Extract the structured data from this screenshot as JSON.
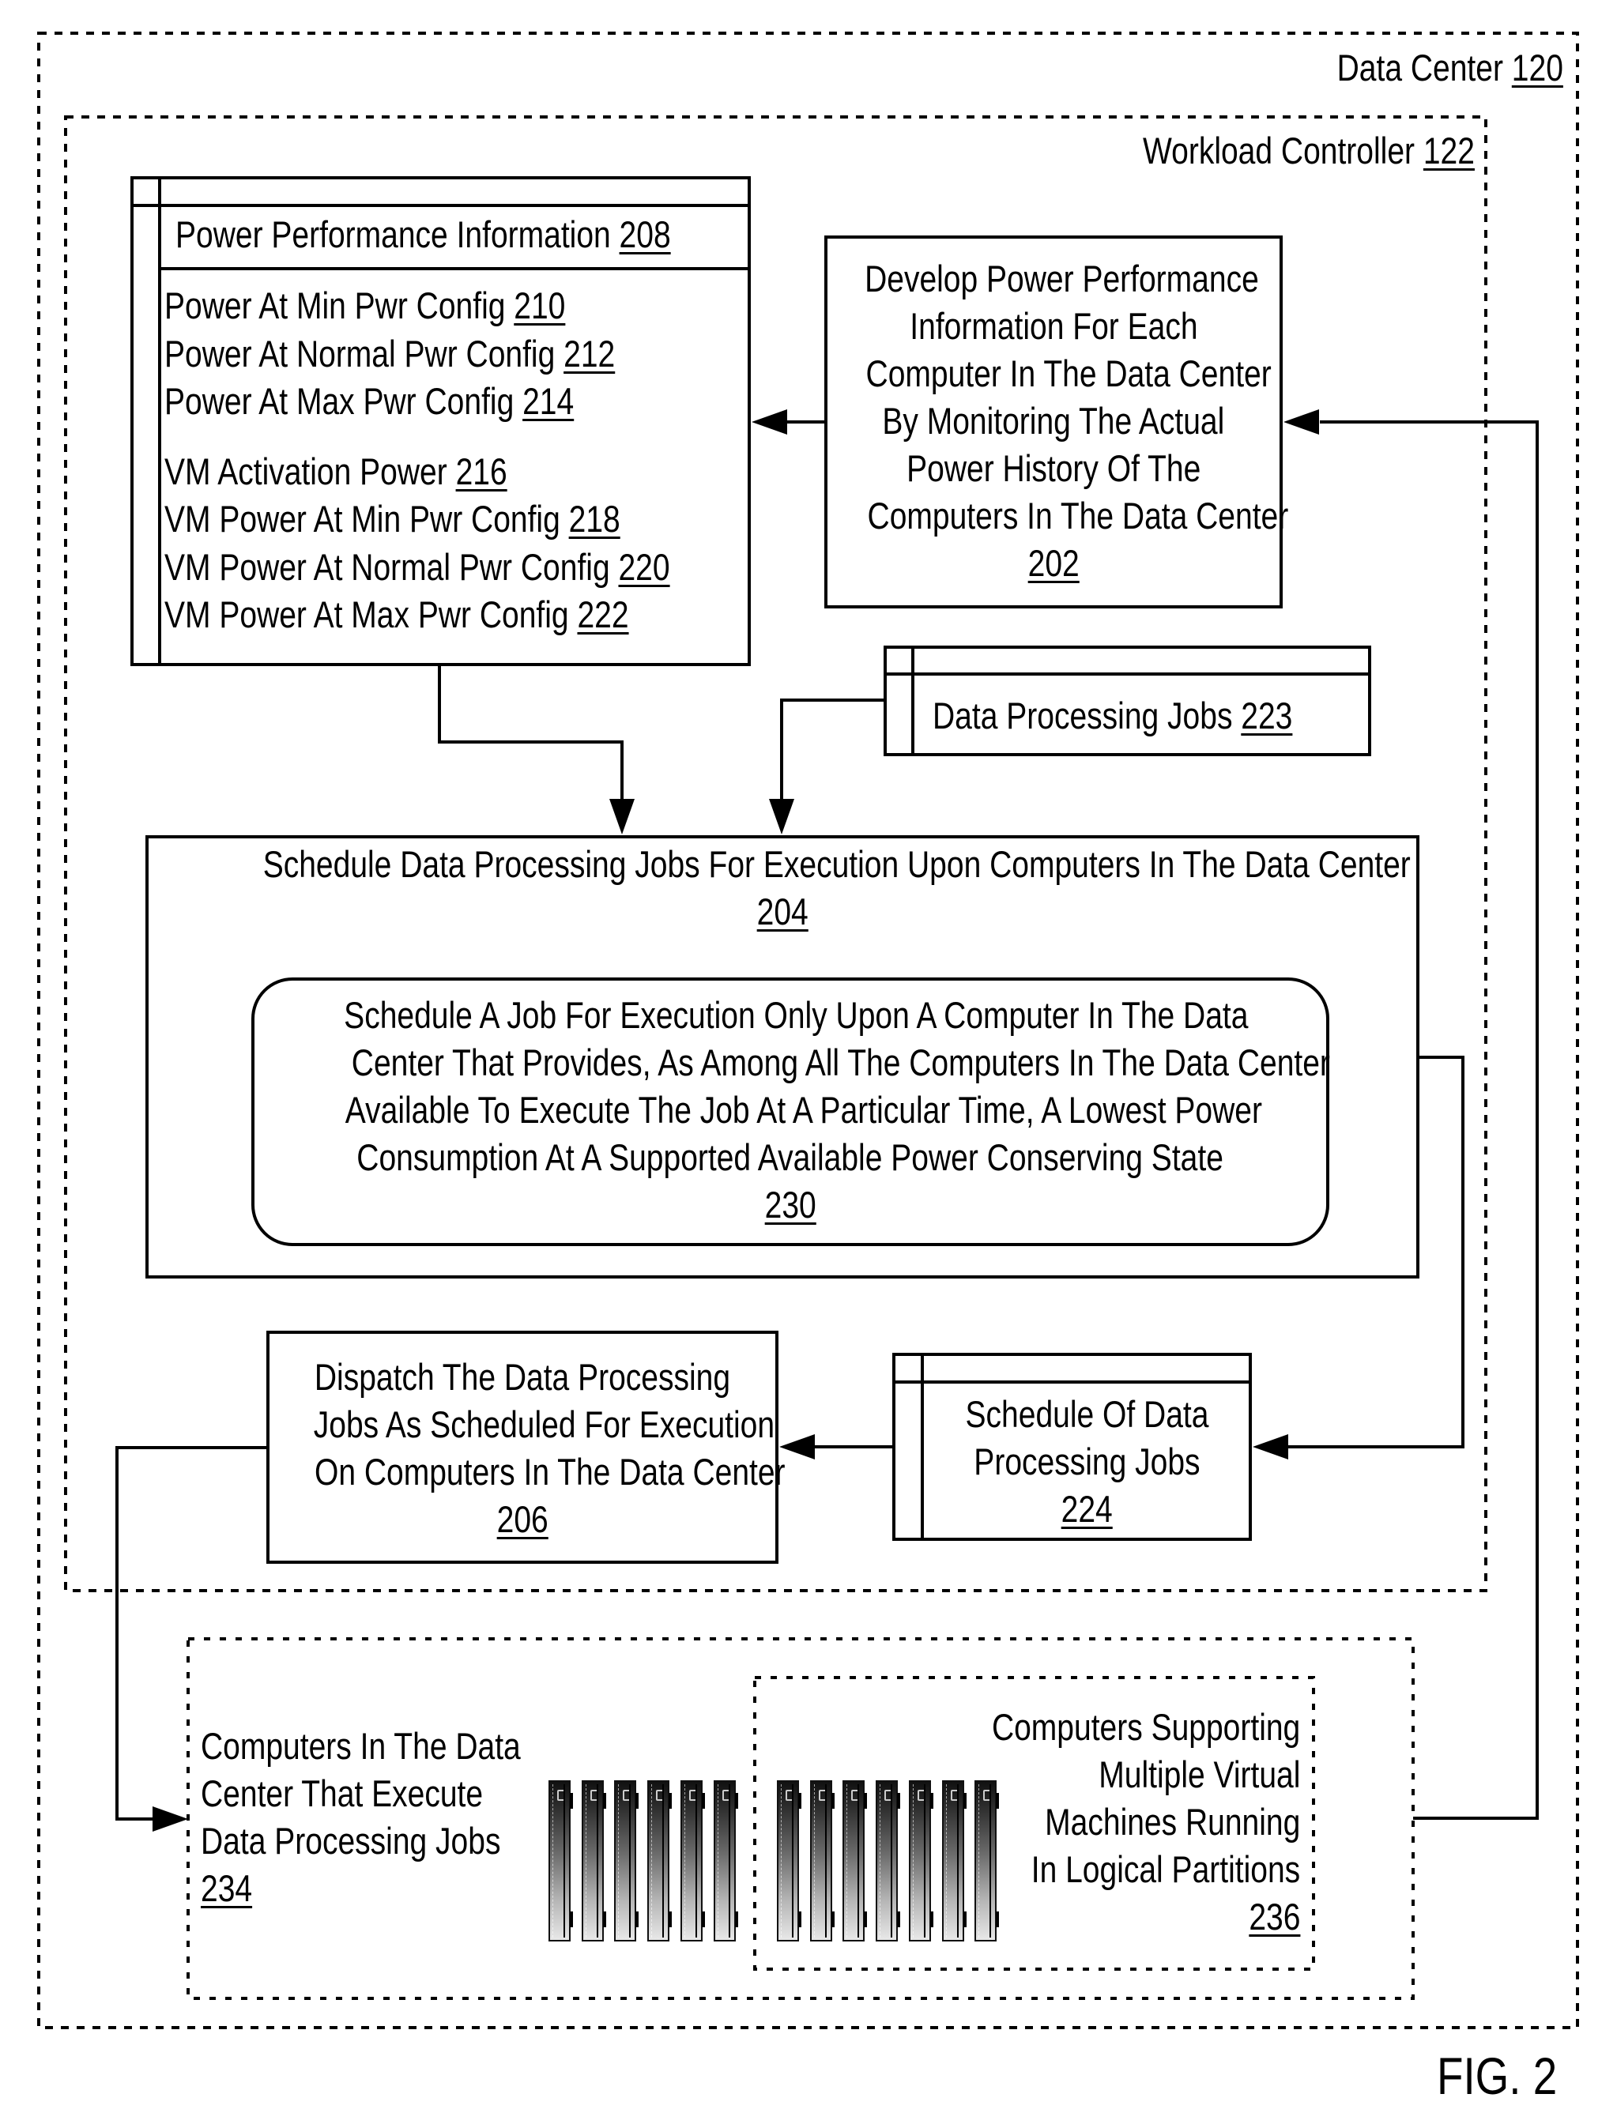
{
  "figure": {
    "label": "FIG. 2"
  },
  "data_center": {
    "label": "Data Center ",
    "ref": "120"
  },
  "workload_controller": {
    "label": "Workload Controller  ",
    "ref": "122"
  },
  "power_performance_info": {
    "title": "Power Performance Information  ",
    "ref": "208",
    "groups": [
      [
        {
          "label": "Power At Min Pwr Config  ",
          "ref": "210"
        },
        {
          "label": "Power At Normal Pwr Config  ",
          "ref": "212"
        },
        {
          "label": "Power At Max Pwr Config  ",
          "ref": "214"
        }
      ],
      [
        {
          "label": "VM Activation Power  ",
          "ref": "216"
        },
        {
          "label": "VM Power At Min Pwr Config  ",
          "ref": "218"
        },
        {
          "label": "VM Power At Normal Pwr Config  ",
          "ref": "220"
        },
        {
          "label": "VM Power At Max Pwr Config  ",
          "ref": "222"
        }
      ]
    ]
  },
  "develop_step": {
    "lines": [
      "Develop Power Performance",
      "Information For Each",
      "Computer In The Data Center",
      "By Monitoring The Actual",
      "Power History Of The",
      "Computers In The Data Center"
    ],
    "ref": "202"
  },
  "data_processing_jobs": {
    "label": "Data Processing Jobs  ",
    "ref": "223"
  },
  "schedule_step": {
    "title": "Schedule Data Processing Jobs For Execution Upon Computers In The Data Center",
    "ref": "204",
    "sub_step": {
      "lines": [
        "Schedule A Job For Execution Only Upon A Computer In The Data",
        "Center That Provides, As Among All The Computers In The Data Center",
        "Available To Execute The Job At A Particular Time, A Lowest Power",
        "Consumption At A Supported Available Power Conserving State"
      ],
      "ref": "230"
    }
  },
  "schedule_store": {
    "lines": [
      "Schedule Of Data",
      "Processing Jobs"
    ],
    "ref": "224"
  },
  "dispatch_step": {
    "lines": [
      "Dispatch The Data Processing",
      "Jobs As Scheduled For Execution",
      "On Computers In The Data Center"
    ],
    "ref": "206"
  },
  "computers": {
    "lines": [
      "Computers In The Data",
      "Center That Execute",
      "Data Processing Jobs"
    ],
    "ref": "234",
    "server_count": 6,
    "server_icon": "server-rack-icon"
  },
  "vm_computers": {
    "lines": [
      "Computers Supporting",
      "Multiple Virtual",
      "Machines Running",
      "In Logical Partitions"
    ],
    "ref": "236",
    "server_count": 7,
    "server_icon": "server-rack-icon"
  }
}
